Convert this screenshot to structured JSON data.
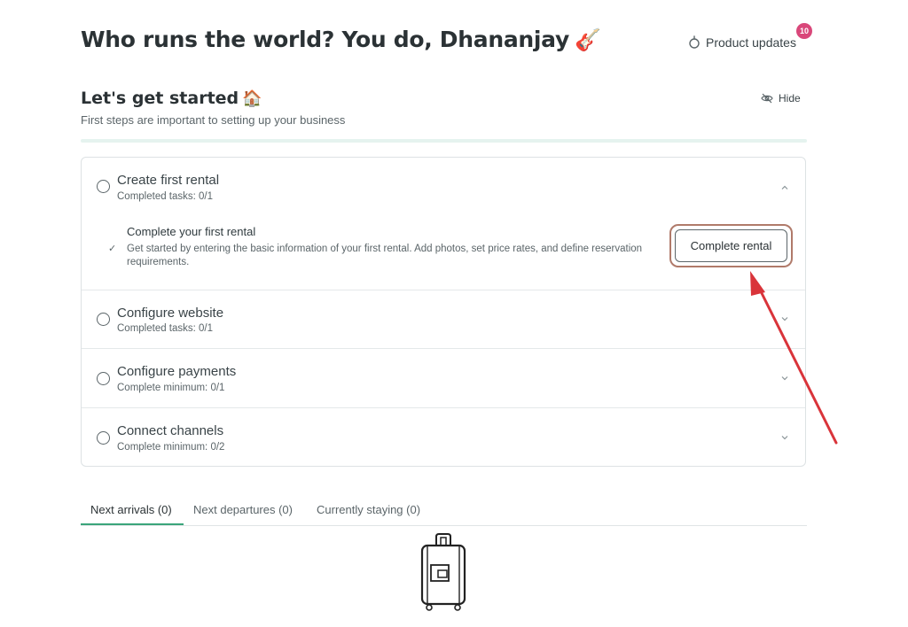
{
  "header": {
    "title": "Who runs the world? You do, Dhananjay",
    "title_emoji": "🎸",
    "updates_label": "Product updates",
    "updates_count": "10"
  },
  "onboarding": {
    "title": "Let's get started",
    "title_emoji": "🏠",
    "subtitle": "First steps are important to setting up your business",
    "hide_label": "Hide",
    "progress_fraction": 0,
    "steps": [
      {
        "title": "Create first rental",
        "meta": "Completed tasks: 0/1",
        "expanded": true,
        "task": {
          "check": "✓",
          "title": "Complete your first rental",
          "description": "Get started by entering the basic information of your first rental. Add photos, set price rates, and define reservation requirements.",
          "button": "Complete rental"
        }
      },
      {
        "title": "Configure website",
        "meta": "Completed tasks: 0/1"
      },
      {
        "title": "Configure payments",
        "meta": "Complete minimum: 0/1"
      },
      {
        "title": "Connect channels",
        "meta": "Complete minimum: 0/2"
      }
    ]
  },
  "tabs": [
    {
      "label": "Next arrivals (0)",
      "active": true
    },
    {
      "label": "Next departures (0)",
      "active": false
    },
    {
      "label": "Currently staying (0)",
      "active": false
    }
  ],
  "colors": {
    "accent": "#3aa57a",
    "badge": "#d9477a",
    "annotation_arrow": "#d9343a",
    "highlight_ring": "#b07a6a"
  }
}
